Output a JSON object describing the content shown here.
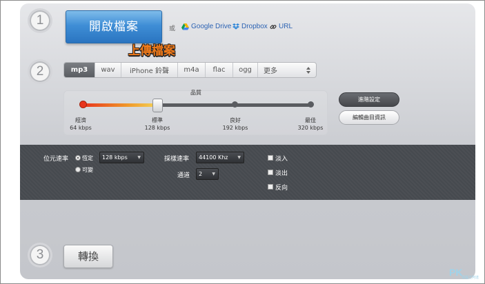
{
  "steps": [
    "1",
    "2",
    "3"
  ],
  "upload": {
    "open_label": "開啟檔案",
    "or_text": "或",
    "sources": [
      {
        "label": "Google Drive",
        "icon": "google-drive-icon"
      },
      {
        "label": "Dropbox",
        "icon": "dropbox-icon"
      },
      {
        "label": "URL",
        "icon": "link-icon"
      }
    ],
    "annotation": "上傳檔案"
  },
  "formats": {
    "tabs": [
      "mp3",
      "wav",
      "iPhone 鈴聲",
      "m4a",
      "flac",
      "ogg",
      "更多"
    ],
    "active": "mp3",
    "more_icon": "updown-arrows-icon"
  },
  "quality": {
    "title": "品質",
    "levels": [
      {
        "name": "經濟",
        "rate": "64 kbps"
      },
      {
        "name": "標準",
        "rate": "128 kbps"
      },
      {
        "name": "良好",
        "rate": "192 kbps"
      },
      {
        "name": "最佳",
        "rate": "320 kbps"
      }
    ],
    "selected_index": 1,
    "selected_fraction": 0.33
  },
  "side_buttons": {
    "advanced": "進階設定",
    "edit_info": "編輯曲目資訊"
  },
  "advanced": {
    "bitrate_label": "位元速率",
    "bitrate_modes": [
      {
        "label": "恆定",
        "checked": true
      },
      {
        "label": "可變",
        "checked": false
      }
    ],
    "bitrate_value": "128 kbps",
    "samplerate_label": "採樣速率",
    "samplerate_value": "44100 Khz",
    "channels_label": "通道",
    "channels_value": "2",
    "effects": [
      {
        "label": "淡入",
        "checked": false
      },
      {
        "label": "淡出",
        "checked": false
      },
      {
        "label": "反向",
        "checked": false
      }
    ]
  },
  "convert": {
    "label": "轉換"
  },
  "watermark": {
    "logo": "PK",
    "sub": "電腦王阿達"
  },
  "colors": {
    "accent_blue": "#3f8ed6",
    "upload_tag": "#f07a1a",
    "dark_panel": "#4a4d52"
  }
}
